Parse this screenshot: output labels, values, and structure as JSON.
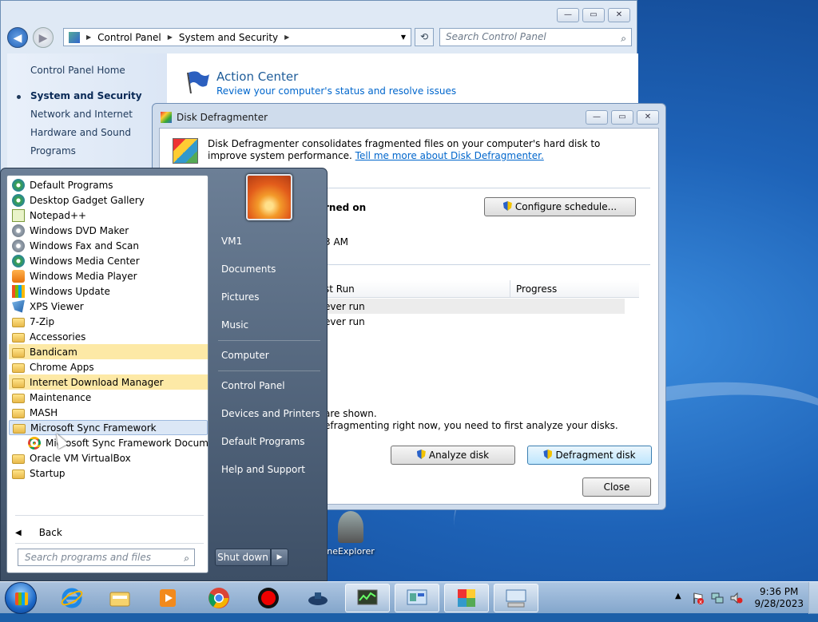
{
  "control_panel": {
    "address": [
      "Control Panel",
      "System and Security"
    ],
    "search_placeholder": "Search Control Panel",
    "sidebar": [
      "Control Panel Home",
      "System and Security",
      "Network and Internet",
      "Hardware and Sound",
      "Programs"
    ],
    "action_center_title": "Action Center",
    "action_center_link": "Review your computer's status and resolve issues"
  },
  "defrag": {
    "title": "Disk Defragmenter",
    "description": "Disk Defragmenter consolidates fragmented files on your computer's hard disk to improve system performance.",
    "learn_link": "Tell me more about Disk Defragmenter.",
    "schedule_status_partial": "rned on",
    "configure_button": "Configure schedule...",
    "next_run_partial": "3 AM",
    "col_last_run": "st Run",
    "col_progress": "Progress",
    "rows": [
      "ever run",
      "ever run"
    ],
    "note1_partial": "are shown.",
    "note2_partial": "efragmenting right now, you need to first analyze your disks.",
    "analyze_button": "Analyze disk",
    "defragment_button": "Defragment disk",
    "close_button": "Close"
  },
  "start_menu": {
    "programs": [
      {
        "label": "Default Programs",
        "icon": "default-programs-icon"
      },
      {
        "label": "Desktop Gadget Gallery",
        "icon": "gadget-gallery-icon"
      },
      {
        "label": "Notepad++",
        "icon": "notepad-icon"
      },
      {
        "label": "Windows DVD Maker",
        "icon": "dvd-maker-icon"
      },
      {
        "label": "Windows Fax and Scan",
        "icon": "fax-scan-icon"
      },
      {
        "label": "Windows Media Center",
        "icon": "media-center-icon"
      },
      {
        "label": "Windows Media Player",
        "icon": "media-player-icon"
      },
      {
        "label": "Windows Update",
        "icon": "windows-update-icon"
      },
      {
        "label": "XPS Viewer",
        "icon": "xps-viewer-icon"
      },
      {
        "label": "7-Zip",
        "icon": "folder-icon"
      },
      {
        "label": "Accessories",
        "icon": "folder-icon"
      },
      {
        "label": "Bandicam",
        "icon": "folder-icon"
      },
      {
        "label": "Chrome Apps",
        "icon": "folder-icon"
      },
      {
        "label": "Internet Download Manager",
        "icon": "folder-icon"
      },
      {
        "label": "Maintenance",
        "icon": "folder-icon"
      },
      {
        "label": "MASH",
        "icon": "folder-icon"
      },
      {
        "label": "Microsoft Sync Framework",
        "icon": "folder-icon"
      },
      {
        "label": "Microsoft Sync Framework Documentation",
        "icon": "chrome-icon"
      },
      {
        "label": "Oracle VM VirtualBox",
        "icon": "folder-icon"
      },
      {
        "label": "Startup",
        "icon": "folder-icon"
      }
    ],
    "back_label": "Back",
    "search_placeholder": "Search programs and files",
    "right_links": [
      "VM1",
      "Documents",
      "Pictures",
      "Music",
      "Computer",
      "Control Panel",
      "Devices and Printers",
      "Default Programs",
      "Help and Support"
    ],
    "shutdown_label": "Shut down"
  },
  "desktop_icon_label": "neExplorer",
  "taskbar": {
    "time": "9:36 PM",
    "date": "9/28/2023"
  },
  "colors": {
    "highlight_new": "#fde9a6",
    "link": "#0066cc"
  }
}
